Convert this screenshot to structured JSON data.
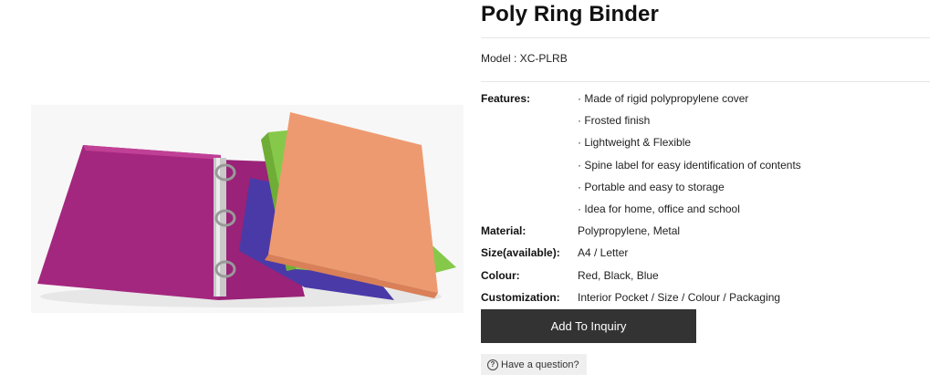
{
  "product": {
    "title": "Poly Ring Binder",
    "model_label": "Model : XC-PLRB"
  },
  "specs": [
    {
      "label": "Features:",
      "value": "· Made of rigid polypropylene cover"
    },
    {
      "label": "",
      "value": "· Frosted finish"
    },
    {
      "label": "",
      "value": "· Lightweight & Flexible"
    },
    {
      "label": "",
      "value": "· Spine label for easy identification of contents"
    },
    {
      "label": "",
      "value": "· Portable and easy to storage"
    },
    {
      "label": "",
      "value": "· Idea for home, office and school"
    },
    {
      "label": "Material:",
      "value": "Polypropylene, Metal"
    },
    {
      "label": "Size(available):",
      "value": "A4 / Letter"
    },
    {
      "label": "Colour:",
      "value": "Red, Black, Blue"
    },
    {
      "label": "Customization:",
      "value": "Interior Pocket / Size / Colour / Packaging"
    }
  ],
  "actions": {
    "add_label": "Add To Inquiry",
    "question_label": "Have a question?",
    "question_icon": "question-circle-icon"
  },
  "colors": {
    "button_dark": "#333333",
    "question_bg": "#efefef",
    "binder_purple": "#a4277f",
    "binder_violet": "#4a3aa8",
    "binder_green": "#86c94a",
    "binder_orange": "#ee9a70"
  }
}
